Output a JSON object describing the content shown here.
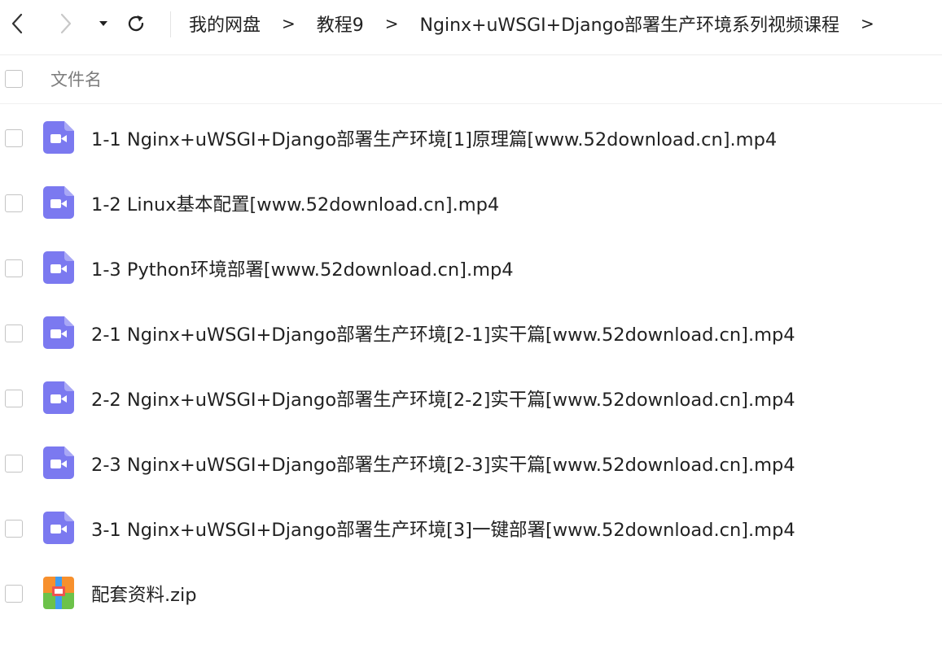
{
  "toolbar": {
    "back_icon": "chevron-left-icon",
    "forward_icon": "chevron-right-icon",
    "history_icon": "caret-down-icon",
    "refresh_icon": "refresh-icon"
  },
  "breadcrumb": [
    {
      "label": "我的网盘"
    },
    {
      "label": "教程9"
    },
    {
      "label": "Nginx+uWSGI+Django部署生产环境系列视频课程"
    }
  ],
  "breadcrumb_separator": ">",
  "list_header": {
    "label": "文件名"
  },
  "files": [
    {
      "name": "1-1 Nginx+uWSGI+Django部署生产环境[1]原理篇[www.52download.cn].mp4",
      "icon": "video-file-icon"
    },
    {
      "name": "1-2 Linux基本配置[www.52download.cn].mp4",
      "icon": "video-file-icon"
    },
    {
      "name": "1-3 Python环境部署[www.52download.cn].mp4",
      "icon": "video-file-icon"
    },
    {
      "name": "2-1 Nginx+uWSGI+Django部署生产环境[2-1]实干篇[www.52download.cn].mp4",
      "icon": "video-file-icon"
    },
    {
      "name": "2-2 Nginx+uWSGI+Django部署生产环境[2-2]实干篇[www.52download.cn].mp4",
      "icon": "video-file-icon"
    },
    {
      "name": "2-3 Nginx+uWSGI+Django部署生产环境[2-3]实干篇[www.52download.cn].mp4",
      "icon": "video-file-icon"
    },
    {
      "name": "3-1 Nginx+uWSGI+Django部署生产环境[3]一键部署[www.52download.cn].mp4",
      "icon": "video-file-icon"
    },
    {
      "name": "配套资料.zip",
      "icon": "zip-archive-icon"
    }
  ],
  "colors": {
    "video_icon": "#7b79f0",
    "zip_orange": "#f7902d",
    "zip_green": "#6cc24a",
    "zip_blue": "#3f9df0",
    "zip_red": "#ef5350"
  }
}
